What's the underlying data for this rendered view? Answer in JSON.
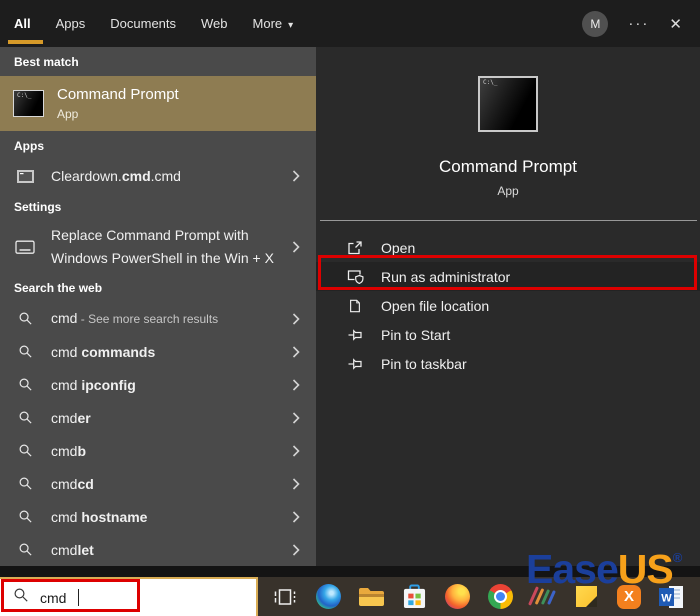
{
  "topbar": {
    "tabs": [
      {
        "label": "All",
        "active": true,
        "dropdown": false
      },
      {
        "label": "Apps",
        "active": false,
        "dropdown": false
      },
      {
        "label": "Documents",
        "active": false,
        "dropdown": false
      },
      {
        "label": "Web",
        "active": false,
        "dropdown": false
      },
      {
        "label": "More",
        "active": false,
        "dropdown": true
      }
    ],
    "dropdown_caret": "▾",
    "avatar_initial": "M",
    "more_options_glyph": "···",
    "close_glyph": "✕"
  },
  "left_panel": {
    "best_match": {
      "header": "Best match",
      "title": "Command Prompt",
      "subtitle": "App",
      "icon": "command-prompt-icon"
    },
    "apps": {
      "header": "Apps",
      "items": [
        {
          "icon": "cmd-file-icon",
          "parts": [
            {
              "t": "Cleardown.",
              "b": false
            },
            {
              "t": "cmd",
              "b": true
            },
            {
              "t": ".cmd",
              "b": false
            }
          ]
        }
      ]
    },
    "settings": {
      "header": "Settings",
      "items": [
        {
          "icon": "display-icon",
          "lines": [
            "Replace Command Prompt with",
            "Windows PowerShell in the Win + X"
          ]
        }
      ]
    },
    "search_web": {
      "header": "Search the web",
      "items": [
        {
          "parts": [
            {
              "t": "cmd",
              "b": false
            },
            {
              "t": " - See more search results",
              "b": false,
              "dim": true
            }
          ]
        },
        {
          "parts": [
            {
              "t": "cmd ",
              "b": false
            },
            {
              "t": "commands",
              "b": true
            }
          ]
        },
        {
          "parts": [
            {
              "t": "cmd ",
              "b": false
            },
            {
              "t": "ipconfig",
              "b": true
            }
          ]
        },
        {
          "parts": [
            {
              "t": "cmd",
              "b": false
            },
            {
              "t": "er",
              "b": true
            }
          ]
        },
        {
          "parts": [
            {
              "t": "cmd",
              "b": false
            },
            {
              "t": "b",
              "b": true
            }
          ]
        },
        {
          "parts": [
            {
              "t": "cmd",
              "b": false
            },
            {
              "t": "cd",
              "b": true
            }
          ]
        },
        {
          "parts": [
            {
              "t": "cmd ",
              "b": false
            },
            {
              "t": "hostname",
              "b": true
            }
          ]
        },
        {
          "parts": [
            {
              "t": "cmd",
              "b": false
            },
            {
              "t": "let",
              "b": true
            }
          ]
        }
      ]
    }
  },
  "right_panel": {
    "app_title": "Command Prompt",
    "app_subtitle": "App",
    "app_icon": "command-prompt-icon",
    "actions": [
      {
        "label": "Open",
        "icon": "open-icon",
        "highlighted": false
      },
      {
        "label": "Run as administrator",
        "icon": "run-as-admin-icon",
        "highlighted": true
      },
      {
        "label": "Open file location",
        "icon": "file-location-icon",
        "highlighted": false
      },
      {
        "label": "Pin to Start",
        "icon": "pin-icon",
        "highlighted": false
      },
      {
        "label": "Pin to taskbar",
        "icon": "pin-icon",
        "highlighted": false
      }
    ]
  },
  "taskbar": {
    "search_value": "cmd",
    "search_icon": "search-icon",
    "icons": [
      "task-view-icon",
      "edge-icon",
      "file-explorer-icon",
      "microsoft-store-icon",
      "firefox-icon",
      "chrome-icon",
      "pens-icon",
      "sticky-notes-icon",
      "xampp-icon",
      "word-icon"
    ]
  },
  "watermark": {
    "part1": "Ease",
    "part2": "US",
    "registered": "®"
  },
  "colors": {
    "accent_gold": "#d79a29",
    "best_match_bg": "#8e7c52",
    "annotation_red": "#dd0000",
    "left_panel_bg": "#4a4a4a",
    "right_panel_bg": "#2a2a2a",
    "taskbar_bg": "#38322b",
    "watermark_blue": "#1b3f9b",
    "watermark_orange": "#f7a11a"
  }
}
